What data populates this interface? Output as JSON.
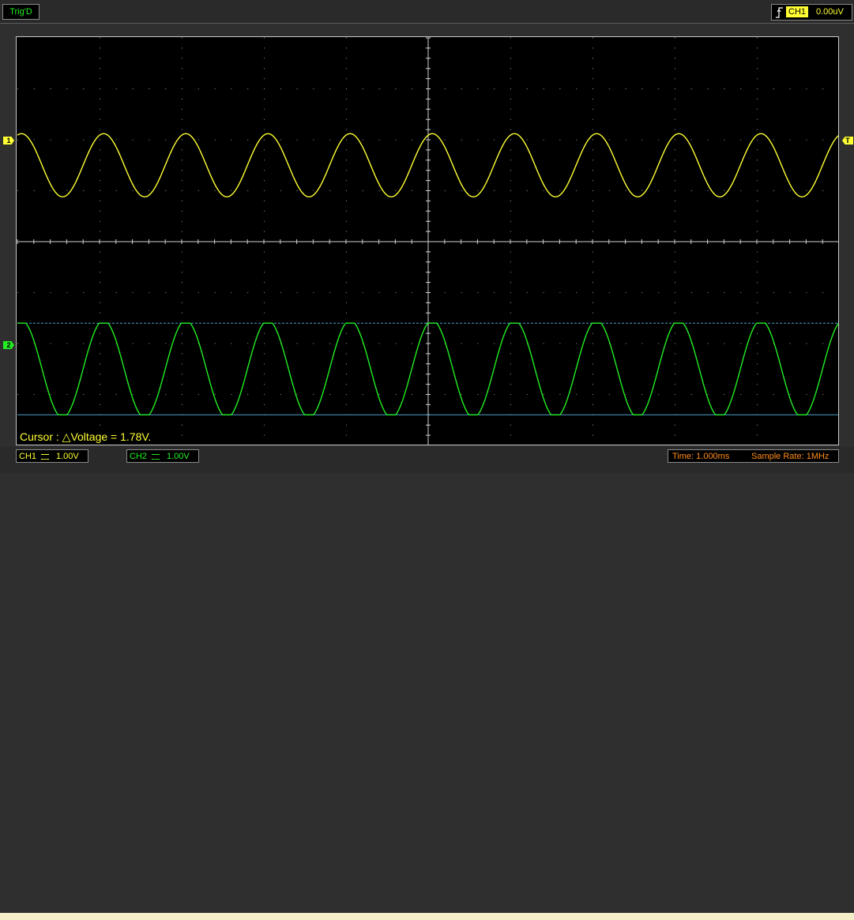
{
  "top": {
    "trigger_state": "Trig'D",
    "trigger_source": "CH1",
    "trigger_level": "0.00uV",
    "trigger_icon": "rising-edge-icon"
  },
  "markers": {
    "ch1": "1",
    "ch2": "2",
    "trigger": "T"
  },
  "cursor_readout": "Cursor : △Voltage = 1.78V.",
  "bottom": {
    "ch1_label": "CH1",
    "ch1_scale": "1.00V",
    "ch2_label": "CH2",
    "ch2_scale": "1.00V",
    "time": "Time: 1.000ms",
    "sample_rate": "Sample Rate: 1MHz"
  },
  "colors": {
    "ch1": "#ffff33",
    "ch2": "#22ee22",
    "grid": "#cfcfcf",
    "cursor": "#4aa0c8",
    "info": "#ff8c1a",
    "background": "#000000"
  },
  "traces": {
    "ch1": {
      "shape": "sine",
      "cycles": 10,
      "amplitude_div": 0.62
    },
    "ch2": {
      "shape": "clipped-sine",
      "cycles": 10,
      "amplitude_div": 0.9
    }
  }
}
